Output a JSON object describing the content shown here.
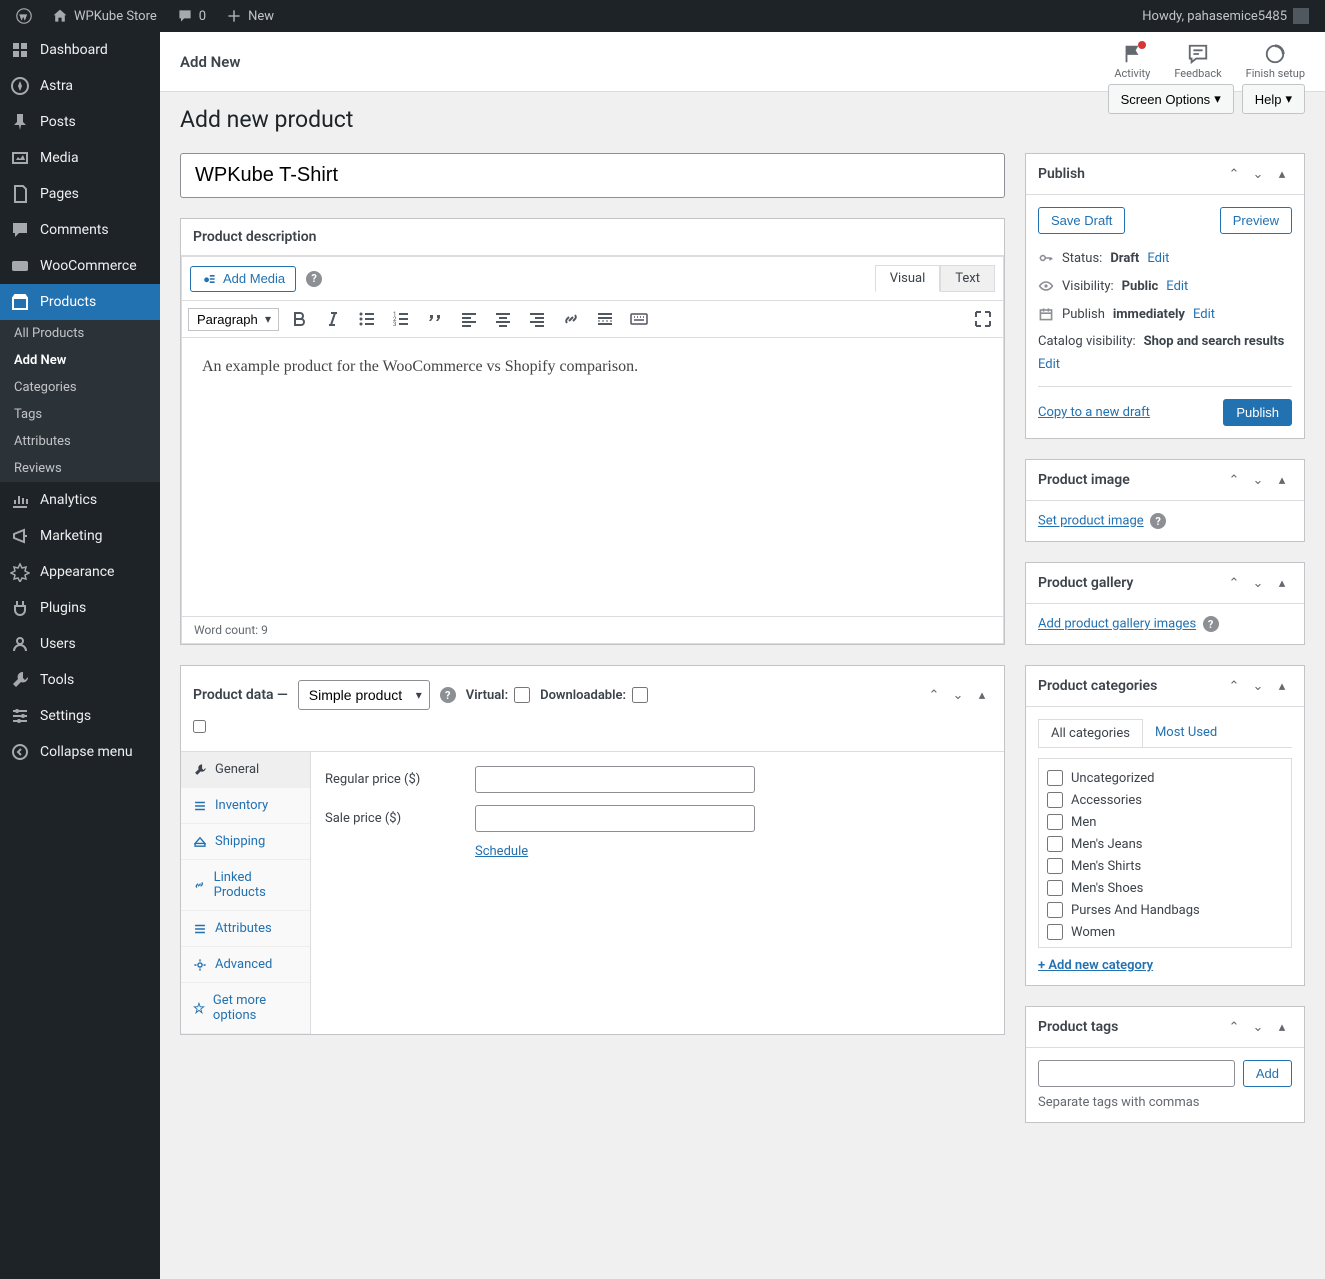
{
  "adminbar": {
    "site_name": "WPKube Store",
    "comments": "0",
    "new": "New",
    "greeting": "Howdy, pahasemice5485"
  },
  "sidebar": {
    "items": [
      {
        "icon": "dashboard",
        "label": "Dashboard"
      },
      {
        "icon": "astra",
        "label": "Astra"
      },
      {
        "icon": "pin",
        "label": "Posts"
      },
      {
        "icon": "media",
        "label": "Media"
      },
      {
        "icon": "pages",
        "label": "Pages"
      },
      {
        "icon": "comments",
        "label": "Comments"
      },
      {
        "icon": "woo",
        "label": "WooCommerce"
      },
      {
        "icon": "products",
        "label": "Products",
        "current": true,
        "submenu": [
          "All Products",
          "Add New",
          "Categories",
          "Tags",
          "Attributes",
          "Reviews"
        ],
        "submenu_current": "Add New"
      },
      {
        "icon": "analytics",
        "label": "Analytics"
      },
      {
        "icon": "marketing",
        "label": "Marketing"
      },
      {
        "icon": "appearance",
        "label": "Appearance"
      },
      {
        "icon": "plugins",
        "label": "Plugins"
      },
      {
        "icon": "users",
        "label": "Users"
      },
      {
        "icon": "tools",
        "label": "Tools"
      },
      {
        "icon": "settings",
        "label": "Settings"
      },
      {
        "icon": "collapse",
        "label": "Collapse menu"
      }
    ]
  },
  "topbar": {
    "title": "Add New",
    "actions": {
      "activity": "Activity",
      "feedback": "Feedback",
      "finish": "Finish setup"
    }
  },
  "header_buttons": {
    "screen_options": "Screen Options",
    "help": "Help"
  },
  "page_title": "Add new product",
  "product_title": "WPKube T-Shirt",
  "description": {
    "title": "Product description",
    "add_media": "Add Media",
    "tab_visual": "Visual",
    "tab_text": "Text",
    "format": "Paragraph",
    "body": "An example product for the WooCommerce vs Shopify comparison.",
    "word_count": "Word count: 9"
  },
  "product_data": {
    "title": "Product data —",
    "type": "Simple product",
    "virtual": "Virtual:",
    "downloadable": "Downloadable:",
    "tabs": [
      "General",
      "Inventory",
      "Shipping",
      "Linked Products",
      "Attributes",
      "Advanced",
      "Get more options"
    ],
    "regular_price_label": "Regular price ($)",
    "sale_price_label": "Sale price ($)",
    "schedule": "Schedule"
  },
  "publish": {
    "title": "Publish",
    "save_draft": "Save Draft",
    "preview": "Preview",
    "status_label": "Status:",
    "status_value": "Draft",
    "visibility_label": "Visibility:",
    "visibility_value": "Public",
    "publish_label": "Publish",
    "publish_value": "immediately",
    "catalog_label": "Catalog visibility:",
    "catalog_value": "Shop and search results",
    "edit": "Edit",
    "copy": "Copy to a new draft",
    "publish_btn": "Publish"
  },
  "product_image": {
    "title": "Product image",
    "link": "Set product image"
  },
  "product_gallery": {
    "title": "Product gallery",
    "link": "Add product gallery images"
  },
  "categories": {
    "title": "Product categories",
    "tab_all": "All categories",
    "tab_most": "Most Used",
    "items": [
      "Uncategorized",
      "Accessories",
      "Men",
      "Men's Jeans",
      "Men's Shirts",
      "Men's Shoes",
      "Purses And Handbags",
      "Women"
    ],
    "add_new": "+ Add new category"
  },
  "tags": {
    "title": "Product tags",
    "add": "Add",
    "hint": "Separate tags with commas"
  }
}
